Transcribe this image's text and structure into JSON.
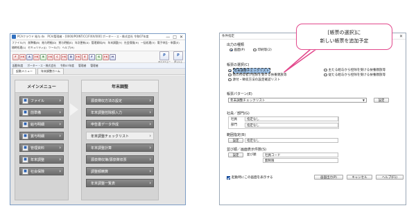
{
  "left_window": {
    "title": "PCAクラウド 給与 dx　PCA/管理者 - [0000/POINT/CC/FIXX/000] ポーター・エ・株式会社 令和07年度",
    "window_controls": [
      "—",
      "□",
      "✕"
    ],
    "menu_items": [
      "ファイル(F)",
      "前準備(B)",
      "給与明細(D)",
      "賞与明細(S)",
      "年次更新(A)",
      "管理資料(R)",
      "年末調整(Y)",
      "社会保険(H)",
      "一括処理(V)",
      "電子申告・申請(E)",
      "随時処理(L)",
      "セキュリティ(J)",
      "ツール(T)",
      "ヘルプ(H)"
    ],
    "toolbar_icons": [
      {
        "label": "F",
        "icon": "file-icon",
        "tone": "red"
      },
      {
        "label": "I-X",
        "icon": "import-icon",
        "tone": "red"
      },
      {
        "label": "A",
        "icon": "employee-icon",
        "tone": "blue"
      },
      {
        "label": "I-X",
        "icon": "export-icon",
        "tone": "red"
      },
      {
        "label": "B",
        "icon": "calendar-icon",
        "tone": "green"
      },
      {
        "label": "I-X",
        "icon": "print-icon",
        "tone": "red"
      },
      {
        "label": "C",
        "icon": "calc-icon",
        "tone": "red"
      },
      {
        "label": "I-X",
        "icon": "output-icon",
        "tone": "red"
      },
      {
        "label": "D",
        "icon": "check-icon",
        "tone": "blue"
      },
      {
        "label": "I-X",
        "icon": "transfer-icon",
        "tone": "red"
      },
      {
        "label": "E",
        "icon": "edit-icon",
        "tone": "red"
      },
      {
        "label": "F",
        "icon": "mail-icon",
        "tone": "blue"
      },
      {
        "label": "G",
        "icon": "book-icon",
        "tone": "green"
      },
      {
        "label": "I-X",
        "icon": "sync-icon",
        "tone": "red"
      },
      {
        "label": "H",
        "icon": "settings-icon",
        "tone": "blue"
      }
    ],
    "toolbar_right": [
      {
        "label": "P",
        "caption": "マイメニュー",
        "icon": "my-menu-icon"
      },
      {
        "label": "P",
        "caption": "ダッシュ",
        "icon": "dashboard-icon"
      }
    ],
    "infobar": [
      "起動年度",
      "ポーター・エ・株式会社",
      "令和07年度",
      "管理者",
      "管理者"
    ],
    "tabs": [
      "起動メニュー",
      "年末調整ホーム"
    ],
    "main_column": {
      "header": "メインメニュー",
      "items": [
        {
          "label": "ファイル",
          "icon": "folder-icon"
        },
        {
          "label": "前準備",
          "icon": "setup-icon"
        },
        {
          "label": "給与明細",
          "icon": "payslip-icon"
        },
        {
          "label": "賞与明細",
          "icon": "bonus-icon"
        },
        {
          "label": "管理資料",
          "icon": "report-icon"
        },
        {
          "label": "年末調整",
          "icon": "year-end-icon"
        },
        {
          "label": "社会保険",
          "icon": "insurance-icon"
        }
      ]
    },
    "year_end_column": {
      "header": "年末調整",
      "items": [
        {
          "label": "源泉徴収方法の設定",
          "active": false
        },
        {
          "label": "年末調整控除額入力",
          "active": false
        },
        {
          "label": "申告書データ作成",
          "active": false
        },
        {
          "label": "年末調整チェックリスト",
          "active": true
        },
        {
          "label": "年末調整計算",
          "active": false
        },
        {
          "label": "源泉徴収簿/源泉徴収票",
          "active": false
        },
        {
          "label": "調整額精算",
          "active": false
        },
        {
          "label": "年末調整一覧表",
          "active": false
        }
      ]
    }
  },
  "dialog": {
    "title": "条件指定",
    "close": "✕",
    "output_type_label": "出力の種類",
    "output_types": [
      {
        "label": "画面(P)",
        "selected": true
      },
      {
        "label": "印刷等(2)",
        "selected": false
      }
    ],
    "form_select_label": "帳票の選択(C)",
    "forms": [
      {
        "label": "年末調整チェックリスト",
        "selected": true
      },
      {
        "label": "他の所得者が控除を受ける扶養親族等",
        "selected": false
      },
      {
        "label": "源付・徴収方法の設定確認リスト",
        "selected": false
      },
      {
        "label": "主たる給与から控除を受ける扶養親族等",
        "selected": false
      },
      {
        "label": "従たる給与から控除を受ける扶養親族等",
        "selected": false
      }
    ],
    "form_pattern_label": "帳票パターン(E)",
    "form_pattern_value": "年末調整チェックリスト",
    "settings_button": "設定",
    "org_label": "社員／部門(G)",
    "org_rows": [
      {
        "key": "社員",
        "value": "指定なし"
      },
      {
        "key": "部門",
        "value": "指定なし"
      }
    ],
    "range_label": "範囲指定(B)",
    "range_value": "指定なし",
    "sort_label": "並び順／画面表示件数(S)",
    "sort_rows": [
      {
        "key": "並び順",
        "value": "社員コード"
      },
      {
        "key": "",
        "value": "無制限"
      }
    ],
    "startup_checkbox": "起動時にこの画面を表示する",
    "buttons": {
      "screen_output": "画面出力(P)",
      "cancel": "キャンセル",
      "help": "ヘルプ(F1)"
    }
  },
  "callout": {
    "line1": "[帳票の選択]に",
    "line2": "新しい帳票を追加予定"
  },
  "colors": {
    "accent_pink": "#e2478b",
    "highlight_blue": "#9cc0e6",
    "menu_gray": "#777777"
  }
}
